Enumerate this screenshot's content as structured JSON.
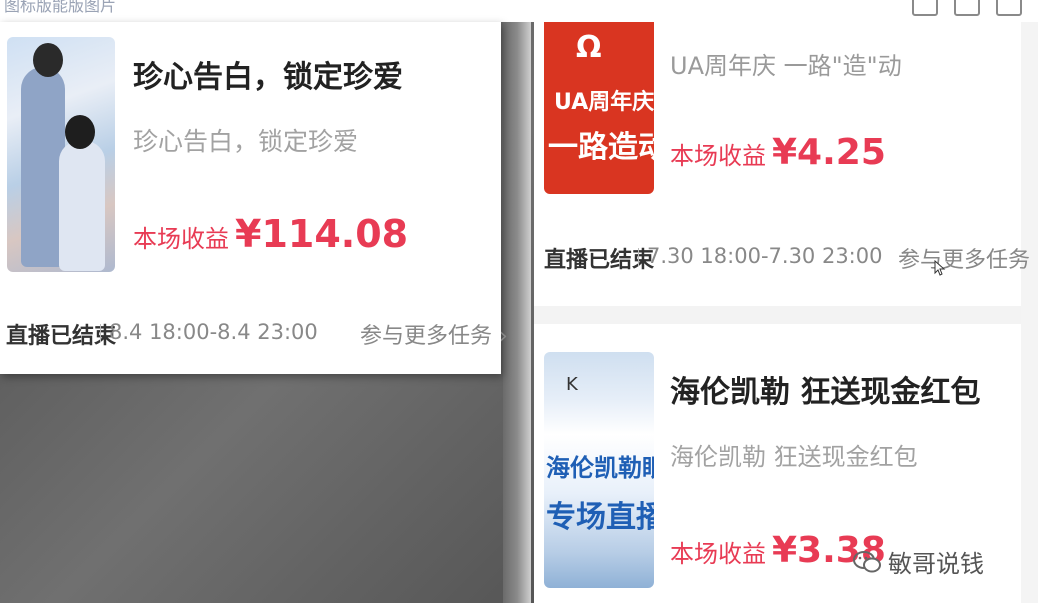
{
  "window": {
    "title": "图标版能版图片"
  },
  "left_card": {
    "title": "珍心告白，锁定珍爱",
    "subtitle": "珍心告白，锁定珍爱",
    "earnings_label": "本场收益",
    "earnings_value": "¥114.08",
    "status": "直播已结束",
    "time_range": "8.4 18:00-8.4 23:00",
    "more_link": "参与更多任务 ›"
  },
  "right_panel": {
    "item1": {
      "poster_logo": "UA周年庆",
      "poster_text": "一路造动",
      "title": "UA周年庆 一路\"造\"动",
      "earnings_label": "本场收益",
      "earnings_value": "¥4.25",
      "status": "直播已结束",
      "time_range": "7.30 18:00-7.30 23:00",
      "more_link": "参与更多任务 ›"
    },
    "item2": {
      "poster_top": "K",
      "poster_line1": "海伦凯勒眼镜",
      "poster_line2": "专场直播",
      "title": "海伦凯勒 狂送现金红包",
      "subtitle": "海伦凯勒 狂送现金红包",
      "earnings_label": "本场收益",
      "earnings_value": "¥3.38"
    },
    "watermark": "敏哥说钱"
  },
  "colors": {
    "accent_red": "#e83b54",
    "text_gray": "#a2a2a2"
  }
}
